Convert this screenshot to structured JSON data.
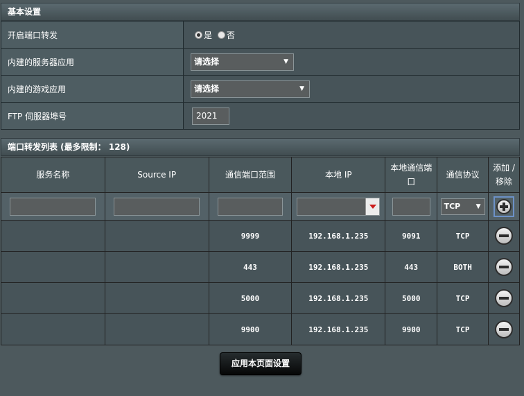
{
  "basic": {
    "header": "基本设置",
    "enable_label": "开启端口转发",
    "yes_label": "是",
    "no_label": "否",
    "server_app_label": "内建的服务器应用",
    "server_app_value": "请选择",
    "game_app_label": "内建的游戏应用",
    "game_app_value": "请选择",
    "ftp_label": "FTP 伺服器埠号",
    "ftp_value": "2021"
  },
  "list": {
    "header": "端口转发列表 (最多限制： 128)",
    "columns": {
      "service": "服务名称",
      "source_ip": "Source IP",
      "port_range": "通信端口范围",
      "local_ip": "本地 IP",
      "local_port_1": "本地通信端",
      "local_port_2": "口",
      "protocol": "通信协议",
      "addremove_1": "添加 /",
      "addremove_2": "移除"
    },
    "new_protocol": "TCP",
    "rows": [
      {
        "service": "",
        "source_ip": "",
        "port_range": "9999",
        "local_ip": "192.168.1.235",
        "local_port": "9091",
        "protocol": "TCP"
      },
      {
        "service": "",
        "source_ip": "",
        "port_range": "443",
        "local_ip": "192.168.1.235",
        "local_port": "443",
        "protocol": "BOTH"
      },
      {
        "service": "",
        "source_ip": "",
        "port_range": "5000",
        "local_ip": "192.168.1.235",
        "local_port": "5000",
        "protocol": "TCP"
      },
      {
        "service": "",
        "source_ip": "",
        "port_range": "9900",
        "local_ip": "192.168.1.235",
        "local_port": "9900",
        "protocol": "TCP"
      }
    ]
  },
  "apply_label": "应用本页面设置"
}
